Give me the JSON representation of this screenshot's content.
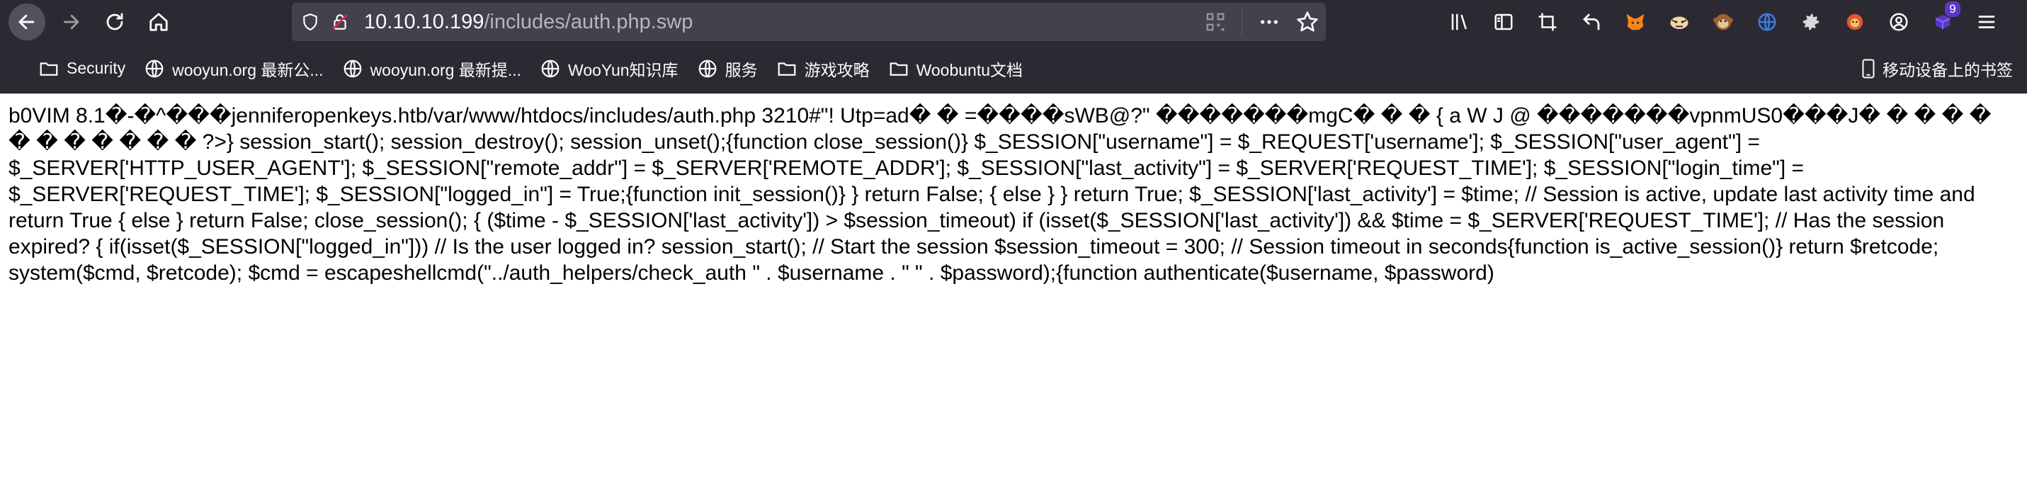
{
  "browser": {
    "url_host": "10.10.10.199",
    "url_path": "/includes/auth.php.swp",
    "extension_badge": "9",
    "icons": {
      "back": "back-arrow-icon",
      "forward": "forward-arrow-icon",
      "reload": "reload-icon",
      "home": "home-icon",
      "shield": "shield-icon",
      "insecure": "insecure-lock-icon",
      "qr": "qr-code-icon",
      "more": "more-dots-icon",
      "star": "star-icon",
      "library": "library-icon",
      "sidebar": "sidebar-icon",
      "crop": "screenshot-icon",
      "undo": "undo-icon",
      "metamask": "fox-icon",
      "tiger": "tiger-icon",
      "monkey": "monkey-icon",
      "globe": "globe-icon",
      "gear": "gear-icon",
      "pet": "pet-icon",
      "account": "account-icon",
      "extension": "extension-icon",
      "menu": "hamburger-menu-icon"
    }
  },
  "bookmarks": [
    {
      "label": "Security",
      "icon": "folder-icon"
    },
    {
      "label": "wooyun.org 最新公...",
      "icon": "globe-icon"
    },
    {
      "label": "wooyun.org 最新提...",
      "icon": "globe-icon"
    },
    {
      "label": "WooYun知识库",
      "icon": "globe-icon"
    },
    {
      "label": "服务",
      "icon": "globe-icon"
    },
    {
      "label": "游戏攻略",
      "icon": "folder-icon"
    },
    {
      "label": "Woobuntu文档",
      "icon": "folder-icon"
    }
  ],
  "mobile_bookmarks": "移动设备上的书签",
  "page": {
    "text": "b0VIM 8.1�-�^���jenniferopenkeys.htb/var/www/htdocs/includes/auth.php 3210#\"! Utp=ad� � =����sWB@?\" �������mgC� � � { a W J @ �������vpnmUS0���J� � � � � � � � � � � � ?>} session_start(); session_destroy(); session_unset();{function close_session()} $_SESSION[\"username\"] = $_REQUEST['username']; $_SESSION[\"user_agent\"] = $_SERVER['HTTP_USER_AGENT']; $_SESSION[\"remote_addr\"] = $_SERVER['REMOTE_ADDR']; $_SESSION[\"last_activity\"] = $_SERVER['REQUEST_TIME']; $_SESSION[\"login_time\"] = $_SERVER['REQUEST_TIME']; $_SESSION[\"logged_in\"] = True;{function init_session()} } return False; { else } } return True; $_SESSION['last_activity'] = $time; // Session is active, update last activity time and return True { else } return False; close_session(); { ($time - $_SESSION['last_activity']) > $session_timeout) if (isset($_SESSION['last_activity']) && $time = $_SERVER['REQUEST_TIME']; // Has the session expired? { if(isset($_SESSION[\"logged_in\"])) // Is the user logged in? session_start(); // Start the session $session_timeout = 300; // Session timeout in seconds{function is_active_session()} return $retcode; system($cmd, $retcode); $cmd = escapeshellcmd(\"../auth_helpers/check_auth \" . $username . \" \" . $password);{function authenticate($username, $password)"
  }
}
